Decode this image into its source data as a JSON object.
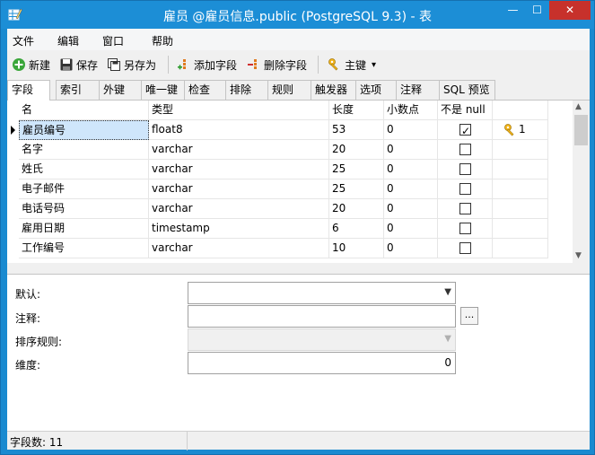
{
  "window": {
    "title": "雇员 @雇员信息.public (PostgreSQL 9.3) - 表",
    "min_glyph": "—",
    "max_glyph": "☐",
    "close_glyph": "✕"
  },
  "menu": [
    "文件",
    "编辑",
    "窗口",
    "帮助"
  ],
  "toolbar": {
    "new_label": "新建",
    "save_label": "保存",
    "save_as_label": "另存为",
    "add_field_label": "添加字段",
    "delete_field_label": "删除字段",
    "primary_key_label": "主键",
    "dropdown_glyph": "▾"
  },
  "tabs": [
    "字段",
    "索引",
    "外键",
    "唯一键",
    "检查",
    "排除",
    "规则",
    "触发器",
    "选项",
    "注释",
    "SQL 预览"
  ],
  "active_tab": "字段",
  "grid": {
    "headers": {
      "name": "名",
      "type": "类型",
      "length": "长度",
      "decimals": "小数点",
      "not_null": "不是 null"
    },
    "rows": [
      {
        "name": "雇员编号",
        "type": "float8",
        "length": "53",
        "decimals": "0",
        "not_null": true,
        "key": "1"
      },
      {
        "name": "名字",
        "type": "varchar",
        "length": "20",
        "decimals": "0",
        "not_null": false,
        "key": ""
      },
      {
        "name": "姓氏",
        "type": "varchar",
        "length": "25",
        "decimals": "0",
        "not_null": false,
        "key": ""
      },
      {
        "name": "电子邮件",
        "type": "varchar",
        "length": "25",
        "decimals": "0",
        "not_null": false,
        "key": ""
      },
      {
        "name": "电话号码",
        "type": "varchar",
        "length": "20",
        "decimals": "0",
        "not_null": false,
        "key": ""
      },
      {
        "name": "雇用日期",
        "type": "timestamp",
        "length": "6",
        "decimals": "0",
        "not_null": false,
        "key": ""
      },
      {
        "name": "工作编号",
        "type": "varchar",
        "length": "10",
        "decimals": "0",
        "not_null": false,
        "key": ""
      }
    ]
  },
  "properties": {
    "default_label": "默认:",
    "comment_label": "注释:",
    "collation_label": "排序规则:",
    "dimension_label": "维度:",
    "dimension_value": "0",
    "ellipsis": "..."
  },
  "status": {
    "field_count": "字段数: 11"
  },
  "colors": {
    "titlebar": "#1c8ed6",
    "close_button": "#c7312b",
    "selection": "#cfe6fb"
  }
}
